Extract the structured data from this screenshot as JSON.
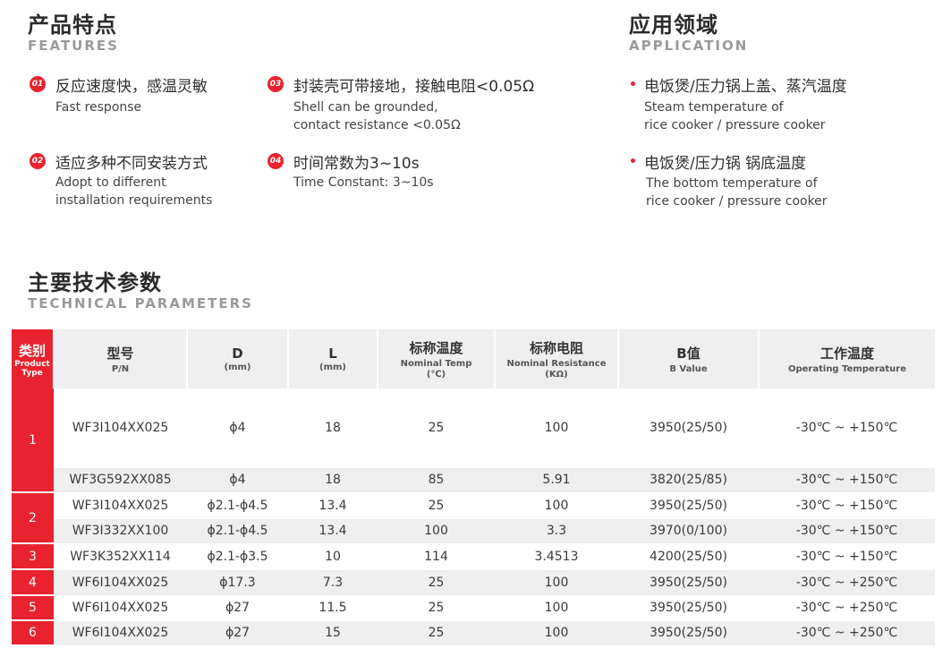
{
  "features": {
    "title_zh": "产品特点",
    "title_en": "FEATURES",
    "items": [
      {
        "num": "01",
        "zh": "反应速度快，感温灵敏",
        "en": [
          "Fast response"
        ]
      },
      {
        "num": "02",
        "zh": "适应多种不同安装方式",
        "en": [
          "Adopt to different",
          "installation requirements"
        ]
      },
      {
        "num": "03",
        "zh": "封装壳可带接地，接触电阻<0.05Ω",
        "en": [
          "Shell can be grounded,",
          "contact resistance <0.05Ω"
        ]
      },
      {
        "num": "04",
        "zh": "时间常数为3~10s",
        "en": [
          "Time Constant: 3~10s"
        ]
      }
    ]
  },
  "application": {
    "title_zh": "应用领域",
    "title_en": "APPLICATION",
    "items": [
      {
        "zh": "电饭煲/压力锅上盖、蒸汽温度",
        "en": [
          "Steam temperature of",
          "rice cooker / pressure cooker"
        ]
      },
      {
        "zh": "电饭煲/压力锅 锅底温度",
        "en": [
          "The bottom temperature of",
          "rice cooker / pressure cooker"
        ]
      }
    ]
  },
  "parameters": {
    "title_zh": "主要技术参数",
    "title_en": "TECHNICAL PARAMETERS",
    "headers": [
      {
        "zh": "类别",
        "en": "Product Type",
        "unit": ""
      },
      {
        "zh": "型号",
        "en": "P/N",
        "unit": ""
      },
      {
        "zh": "D",
        "en": "",
        "unit": "(mm)"
      },
      {
        "zh": "L",
        "en": "",
        "unit": "(mm)"
      },
      {
        "zh": "标称温度",
        "en": "Nominal Temp",
        "unit": "(℃)"
      },
      {
        "zh": "标称电阻",
        "en": "Nominal Resistance",
        "unit": "(KΩ)"
      },
      {
        "zh": "B值",
        "en": "B Value",
        "unit": ""
      },
      {
        "zh": "工作温度",
        "en": "Operating Temperature",
        "unit": ""
      }
    ],
    "groups": [
      {
        "type": "1",
        "rows": [
          [
            "WF3I104XX025",
            "ϕ4",
            "18",
            "25",
            "100",
            "3950(25/50)",
            "-30℃ ~ +150℃"
          ],
          [
            "WF3G592XX085",
            "ϕ4",
            "18",
            "85",
            "5.91",
            "3820(25/85)",
            "-30℃ ~ +150℃"
          ]
        ]
      },
      {
        "type": "2",
        "rows": [
          [
            "WF3I104XX025",
            "ϕ2.1-ϕ4.5",
            "13.4",
            "25",
            "100",
            "3950(25/50)",
            "-30℃ ~ +150℃"
          ],
          [
            "WF3I332XX100",
            "ϕ2.1-ϕ4.5",
            "13.4",
            "100",
            "3.3",
            "3970(0/100)",
            "-30℃ ~ +150℃"
          ]
        ]
      },
      {
        "type": "3",
        "rows": [
          [
            "WF3K352XX114",
            "ϕ2.1-ϕ3.5",
            "10",
            "114",
            "3.4513",
            "4200(25/50)",
            "-30℃ ~ +150℃"
          ]
        ]
      },
      {
        "type": "4",
        "rows": [
          [
            "WF6I104XX025",
            "ϕ17.3",
            "7.3",
            "25",
            "100",
            "3950(25/50)",
            "-30℃ ~ +250℃"
          ]
        ]
      },
      {
        "type": "5",
        "rows": [
          [
            "WF6I104XX025",
            "ϕ27",
            "11.5",
            "25",
            "100",
            "3950(25/50)",
            "-30℃ ~ +250℃"
          ]
        ]
      },
      {
        "type": "6",
        "rows": [
          [
            "WF6I104XX025",
            "ϕ27",
            "15",
            "25",
            "100",
            "3950(25/50)",
            "-30℃ ~ +250℃"
          ]
        ]
      }
    ]
  },
  "colors": {
    "accent": "#e8232f",
    "header_bg": "#efefef",
    "subtitle": "#9a9a9a"
  }
}
